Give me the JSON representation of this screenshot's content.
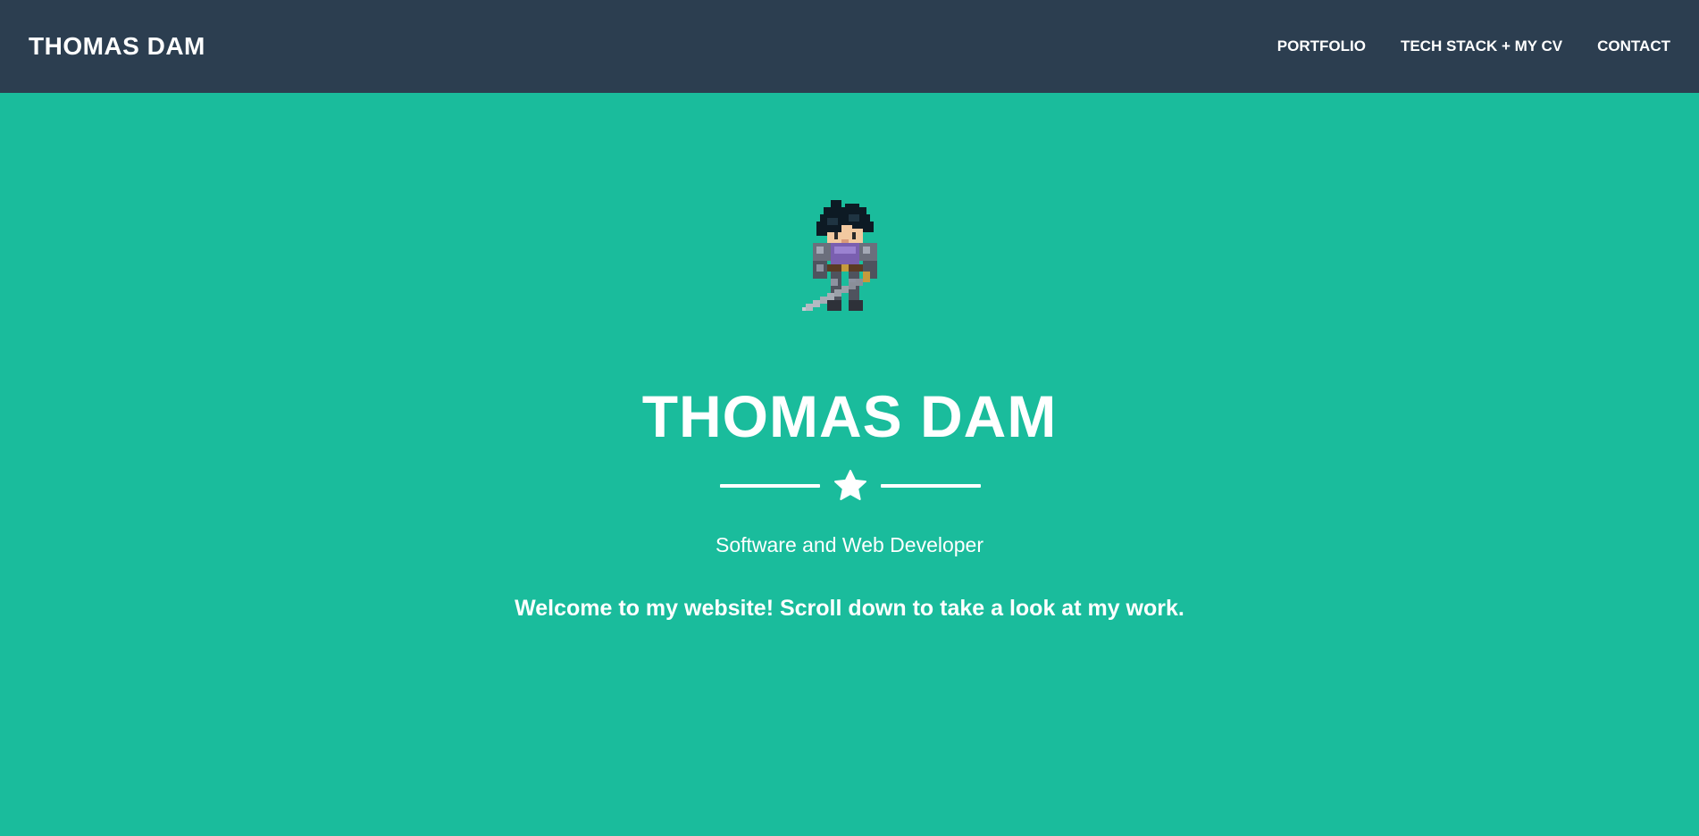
{
  "colors": {
    "navbar_bg": "#2c3e50",
    "hero_bg": "#1abc9c",
    "text": "#ffffff"
  },
  "navbar": {
    "brand": "THOMAS DAM",
    "links": [
      {
        "label": "PORTFOLIO"
      },
      {
        "label": "TECH STACK + MY CV"
      },
      {
        "label": "CONTACT"
      }
    ]
  },
  "hero": {
    "avatar_icon": "pixel-knight-avatar",
    "title": "THOMAS DAM",
    "divider_icon": "star-icon",
    "subtitle": "Software and Web Developer",
    "welcome": "Welcome to my website! Scroll down to take a look at my work."
  }
}
